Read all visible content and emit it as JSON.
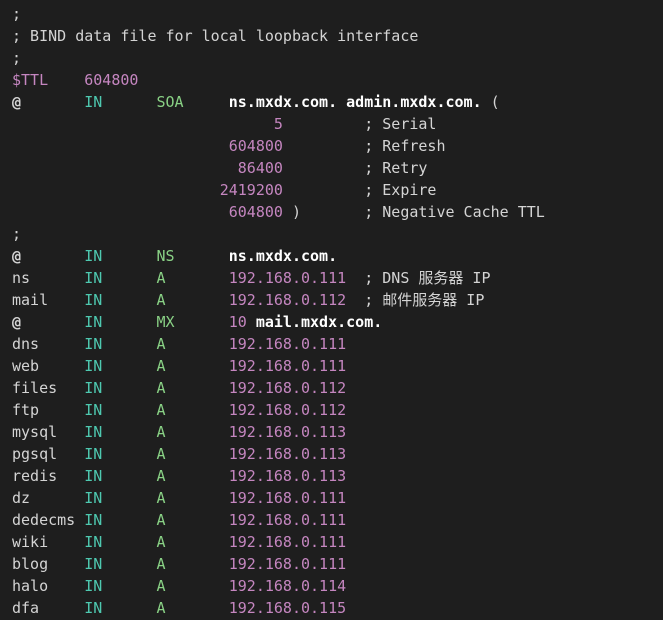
{
  "editor": {
    "colors": {
      "background": "#1e1e1e",
      "default_text": "#d4d4d4",
      "number_purple": "#c586c0",
      "class_teal": "#4ec9b0",
      "type_green": "#89d185",
      "bold_white": "#ffffff"
    },
    "lines": [
      [
        {
          "t": ";",
          "c": "comment"
        }
      ],
      [
        {
          "t": "; BIND data file for local loopback interface",
          "c": "comment"
        }
      ],
      [
        {
          "t": ";",
          "c": "comment"
        }
      ],
      [
        {
          "t": "$TTL",
          "c": "var"
        },
        {
          "t": "    ",
          "c": "plain"
        },
        {
          "t": "604800",
          "c": "num"
        }
      ],
      [
        {
          "t": "@",
          "c": "at"
        },
        {
          "t": "       ",
          "c": "plain"
        },
        {
          "t": "IN",
          "c": "class"
        },
        {
          "t": "      ",
          "c": "plain"
        },
        {
          "t": "SOA",
          "c": "type"
        },
        {
          "t": "     ",
          "c": "plain"
        },
        {
          "t": "ns.mxdx.com.",
          "c": "name"
        },
        {
          "t": " ",
          "c": "plain"
        },
        {
          "t": "admin.mxdx.com.",
          "c": "name"
        },
        {
          "t": " (",
          "c": "plain"
        }
      ],
      [
        {
          "t": "                             ",
          "c": "plain"
        },
        {
          "t": "5",
          "c": "num"
        },
        {
          "t": "         ",
          "c": "plain"
        },
        {
          "t": "; Serial",
          "c": "comment"
        }
      ],
      [
        {
          "t": "                        ",
          "c": "plain"
        },
        {
          "t": "604800",
          "c": "num"
        },
        {
          "t": "         ",
          "c": "plain"
        },
        {
          "t": "; Refresh",
          "c": "comment"
        }
      ],
      [
        {
          "t": "                         ",
          "c": "plain"
        },
        {
          "t": "86400",
          "c": "num"
        },
        {
          "t": "         ",
          "c": "plain"
        },
        {
          "t": "; Retry",
          "c": "comment"
        }
      ],
      [
        {
          "t": "                       ",
          "c": "plain"
        },
        {
          "t": "2419200",
          "c": "num"
        },
        {
          "t": "         ",
          "c": "plain"
        },
        {
          "t": "; Expire",
          "c": "comment"
        }
      ],
      [
        {
          "t": "                        ",
          "c": "plain"
        },
        {
          "t": "604800",
          "c": "num"
        },
        {
          "t": " )       ",
          "c": "plain"
        },
        {
          "t": "; Negative Cache TTL",
          "c": "comment"
        }
      ],
      [
        {
          "t": ";",
          "c": "comment"
        }
      ],
      [
        {
          "t": "@",
          "c": "at"
        },
        {
          "t": "       ",
          "c": "plain"
        },
        {
          "t": "IN",
          "c": "class"
        },
        {
          "t": "      ",
          "c": "plain"
        },
        {
          "t": "NS",
          "c": "type"
        },
        {
          "t": "      ",
          "c": "plain"
        },
        {
          "t": "ns.mxdx.com.",
          "c": "name"
        }
      ],
      [
        {
          "t": "ns",
          "c": "host"
        },
        {
          "t": "      ",
          "c": "plain"
        },
        {
          "t": "IN",
          "c": "class"
        },
        {
          "t": "      ",
          "c": "plain"
        },
        {
          "t": "A",
          "c": "type"
        },
        {
          "t": "       ",
          "c": "plain"
        },
        {
          "t": "192.168.0.111",
          "c": "ip"
        },
        {
          "t": "  ",
          "c": "plain"
        },
        {
          "t": "; DNS 服务器 IP",
          "c": "comment"
        }
      ],
      [
        {
          "t": "mail",
          "c": "host"
        },
        {
          "t": "    ",
          "c": "plain"
        },
        {
          "t": "IN",
          "c": "class"
        },
        {
          "t": "      ",
          "c": "plain"
        },
        {
          "t": "A",
          "c": "type"
        },
        {
          "t": "       ",
          "c": "plain"
        },
        {
          "t": "192.168.0.112",
          "c": "ip"
        },
        {
          "t": "  ",
          "c": "plain"
        },
        {
          "t": "; 邮件服务器 IP",
          "c": "comment"
        }
      ],
      [
        {
          "t": "@",
          "c": "at"
        },
        {
          "t": "       ",
          "c": "plain"
        },
        {
          "t": "IN",
          "c": "class"
        },
        {
          "t": "      ",
          "c": "plain"
        },
        {
          "t": "MX",
          "c": "type"
        },
        {
          "t": "      ",
          "c": "plain"
        },
        {
          "t": "10",
          "c": "num"
        },
        {
          "t": " ",
          "c": "plain"
        },
        {
          "t": "mail.mxdx.com.",
          "c": "name"
        }
      ],
      [
        {
          "t": "dns",
          "c": "host"
        },
        {
          "t": "     ",
          "c": "plain"
        },
        {
          "t": "IN",
          "c": "class"
        },
        {
          "t": "      ",
          "c": "plain"
        },
        {
          "t": "A",
          "c": "type"
        },
        {
          "t": "       ",
          "c": "plain"
        },
        {
          "t": "192.168.0.111",
          "c": "ip"
        }
      ],
      [
        {
          "t": "web",
          "c": "host"
        },
        {
          "t": "     ",
          "c": "plain"
        },
        {
          "t": "IN",
          "c": "class"
        },
        {
          "t": "      ",
          "c": "plain"
        },
        {
          "t": "A",
          "c": "type"
        },
        {
          "t": "       ",
          "c": "plain"
        },
        {
          "t": "192.168.0.111",
          "c": "ip"
        }
      ],
      [
        {
          "t": "files",
          "c": "host"
        },
        {
          "t": "   ",
          "c": "plain"
        },
        {
          "t": "IN",
          "c": "class"
        },
        {
          "t": "      ",
          "c": "plain"
        },
        {
          "t": "A",
          "c": "type"
        },
        {
          "t": "       ",
          "c": "plain"
        },
        {
          "t": "192.168.0.112",
          "c": "ip"
        }
      ],
      [
        {
          "t": "ftp",
          "c": "host"
        },
        {
          "t": "     ",
          "c": "plain"
        },
        {
          "t": "IN",
          "c": "class"
        },
        {
          "t": "      ",
          "c": "plain"
        },
        {
          "t": "A",
          "c": "type"
        },
        {
          "t": "       ",
          "c": "plain"
        },
        {
          "t": "192.168.0.112",
          "c": "ip"
        }
      ],
      [
        {
          "t": "mysql",
          "c": "host"
        },
        {
          "t": "   ",
          "c": "plain"
        },
        {
          "t": "IN",
          "c": "class"
        },
        {
          "t": "      ",
          "c": "plain"
        },
        {
          "t": "A",
          "c": "type"
        },
        {
          "t": "       ",
          "c": "plain"
        },
        {
          "t": "192.168.0.113",
          "c": "ip"
        }
      ],
      [
        {
          "t": "pgsql",
          "c": "host"
        },
        {
          "t": "   ",
          "c": "plain"
        },
        {
          "t": "IN",
          "c": "class"
        },
        {
          "t": "      ",
          "c": "plain"
        },
        {
          "t": "A",
          "c": "type"
        },
        {
          "t": "       ",
          "c": "plain"
        },
        {
          "t": "192.168.0.113",
          "c": "ip"
        }
      ],
      [
        {
          "t": "redis",
          "c": "host"
        },
        {
          "t": "   ",
          "c": "plain"
        },
        {
          "t": "IN",
          "c": "class"
        },
        {
          "t": "      ",
          "c": "plain"
        },
        {
          "t": "A",
          "c": "type"
        },
        {
          "t": "       ",
          "c": "plain"
        },
        {
          "t": "192.168.0.113",
          "c": "ip"
        }
      ],
      [
        {
          "t": "dz",
          "c": "host"
        },
        {
          "t": "      ",
          "c": "plain"
        },
        {
          "t": "IN",
          "c": "class"
        },
        {
          "t": "      ",
          "c": "plain"
        },
        {
          "t": "A",
          "c": "type"
        },
        {
          "t": "       ",
          "c": "plain"
        },
        {
          "t": "192.168.0.111",
          "c": "ip"
        }
      ],
      [
        {
          "t": "dedecms",
          "c": "host"
        },
        {
          "t": " ",
          "c": "plain"
        },
        {
          "t": "IN",
          "c": "class"
        },
        {
          "t": "      ",
          "c": "plain"
        },
        {
          "t": "A",
          "c": "type"
        },
        {
          "t": "       ",
          "c": "plain"
        },
        {
          "t": "192.168.0.111",
          "c": "ip"
        }
      ],
      [
        {
          "t": "wiki",
          "c": "host"
        },
        {
          "t": "    ",
          "c": "plain"
        },
        {
          "t": "IN",
          "c": "class"
        },
        {
          "t": "      ",
          "c": "plain"
        },
        {
          "t": "A",
          "c": "type"
        },
        {
          "t": "       ",
          "c": "plain"
        },
        {
          "t": "192.168.0.111",
          "c": "ip"
        }
      ],
      [
        {
          "t": "blog",
          "c": "host"
        },
        {
          "t": "    ",
          "c": "plain"
        },
        {
          "t": "IN",
          "c": "class"
        },
        {
          "t": "      ",
          "c": "plain"
        },
        {
          "t": "A",
          "c": "type"
        },
        {
          "t": "       ",
          "c": "plain"
        },
        {
          "t": "192.168.0.111",
          "c": "ip"
        }
      ],
      [
        {
          "t": "halo",
          "c": "host"
        },
        {
          "t": "    ",
          "c": "plain"
        },
        {
          "t": "IN",
          "c": "class"
        },
        {
          "t": "      ",
          "c": "plain"
        },
        {
          "t": "A",
          "c": "type"
        },
        {
          "t": "       ",
          "c": "plain"
        },
        {
          "t": "192.168.0.114",
          "c": "ip"
        }
      ],
      [
        {
          "t": "dfa",
          "c": "host"
        },
        {
          "t": "     ",
          "c": "plain"
        },
        {
          "t": "IN",
          "c": "class"
        },
        {
          "t": "      ",
          "c": "plain"
        },
        {
          "t": "A",
          "c": "type"
        },
        {
          "t": "       ",
          "c": "plain"
        },
        {
          "t": "192.168.0.115",
          "c": "ip"
        }
      ]
    ]
  }
}
